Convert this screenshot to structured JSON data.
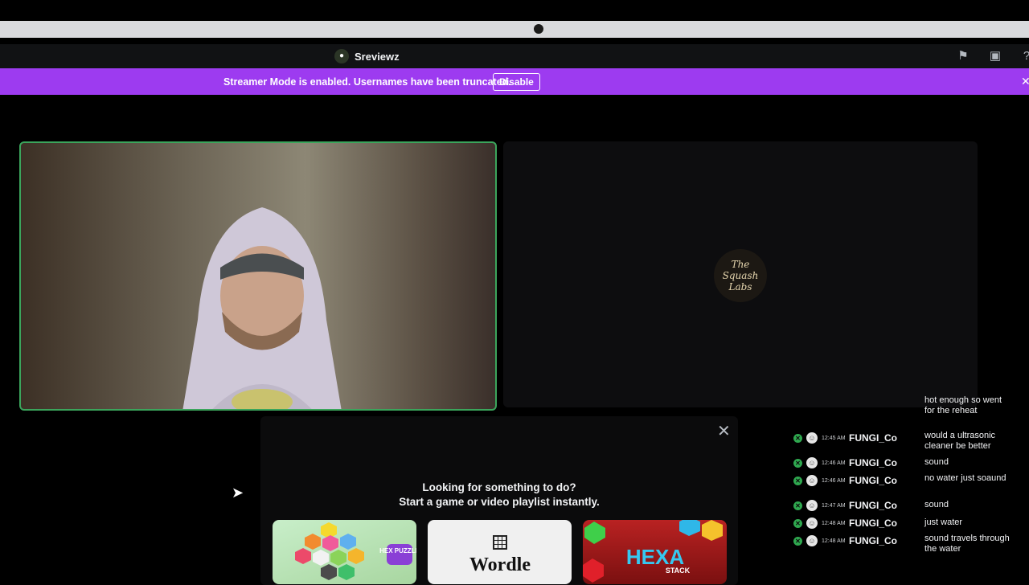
{
  "titlebar": {
    "server_name": "Sreviewz",
    "icons": [
      "flag-icon",
      "screen-record-icon",
      "help-icon"
    ]
  },
  "banner": {
    "text": "Streamer Mode is enabled. Usernames have been truncated.",
    "disable_label": "Disable",
    "close_icon": "✕",
    "color": "#9d3bf0"
  },
  "stage": {
    "empty_tile_logo_text": "The Squash Labs"
  },
  "activity_panel": {
    "heading_line1": "Looking for something to do?",
    "heading_line2": "Start a game or video playlist instantly.",
    "close_icon": "✕",
    "games": [
      {
        "name": "Hex Puzzle",
        "label": "HEX PUZZLE"
      },
      {
        "name": "Wordle",
        "label": "Wordle"
      },
      {
        "name": "Hexa Stack",
        "label": "HEXA",
        "sub": "STACK"
      }
    ]
  },
  "chat": {
    "partial_message": "hot enough so went for the reheat",
    "messages": [
      {
        "time": "12:45 AM",
        "user": "FUNGI_Co",
        "text": "would a ultrasonic cleaner be better"
      },
      {
        "time": "12:46 AM",
        "user": "FUNGI_Co",
        "text": "sound"
      },
      {
        "time": "12:46 AM",
        "user": "FUNGI_Co",
        "text": "no water just soaund"
      },
      {
        "time": "12:47 AM",
        "user": "FUNGI_Co",
        "text": "sound"
      },
      {
        "time": "12:48 AM",
        "user": "FUNGI_Co",
        "text": "just water"
      },
      {
        "time": "12:48 AM",
        "user": "FUNGI_Co",
        "text": "sound travels through the water"
      }
    ],
    "badge_color": "#2fa84f"
  }
}
